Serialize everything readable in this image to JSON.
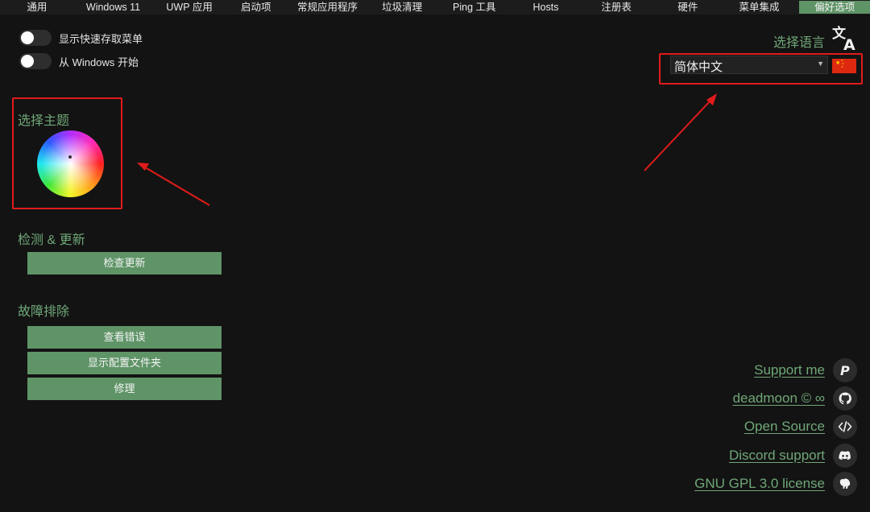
{
  "tabs": [
    {
      "label": "通用",
      "active": false
    },
    {
      "label": "Windows 11",
      "active": false
    },
    {
      "label": "UWP 应用",
      "active": false
    },
    {
      "label": "启动项",
      "active": false
    },
    {
      "label": "常规应用程序",
      "active": false
    },
    {
      "label": "垃圾清理",
      "active": false
    },
    {
      "label": "Ping 工具",
      "active": false
    },
    {
      "label": "Hosts",
      "active": false
    },
    {
      "label": "注册表",
      "active": false
    },
    {
      "label": "硬件",
      "active": false
    },
    {
      "label": "菜单集成",
      "active": false
    },
    {
      "label": "偏好选项",
      "active": true
    }
  ],
  "toggles": [
    {
      "label": "显示快速存取菜单",
      "on": false
    },
    {
      "label": "从 Windows 开始",
      "on": false
    }
  ],
  "theme": {
    "heading": "选择主题"
  },
  "update": {
    "heading": "检测 & 更新",
    "check_button": "检查更新"
  },
  "troubleshoot": {
    "heading": "故障排除",
    "buttons": [
      "查看错误",
      "显示配置文件夹",
      "修理"
    ]
  },
  "language": {
    "label": "选择语言",
    "selected": "简体中文",
    "flag": "china-flag"
  },
  "links": [
    {
      "label": "Support me",
      "icon": "paypal-icon"
    },
    {
      "label": "deadmoon © ∞",
      "icon": "github-icon"
    },
    {
      "label": "Open Source",
      "icon": "code-icon"
    },
    {
      "label": "Discord support",
      "icon": "discord-icon"
    },
    {
      "label": "GNU GPL 3.0 license",
      "icon": "gnu-icon"
    }
  ],
  "colors": {
    "accent": "#5f9467",
    "heading": "#6fa777",
    "background": "#131313",
    "annotation": "#e21b1b"
  }
}
